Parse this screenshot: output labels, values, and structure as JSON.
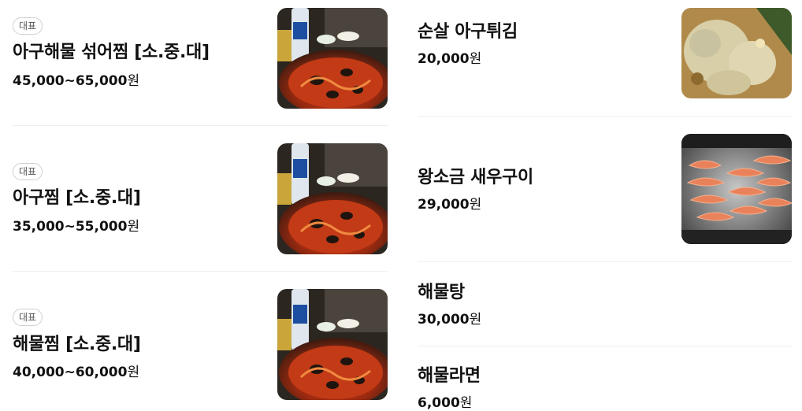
{
  "left_items": [
    {
      "badge": "대표",
      "name": "아구해물 섞어찜 [소.중.대]",
      "price": "45,000~65,000",
      "unit": "원",
      "image": "braised-seafood-photo"
    },
    {
      "badge": "대표",
      "name": "아구찜 [소.중.대]",
      "price": "35,000~55,000",
      "unit": "원",
      "image": "braised-seafood-photo"
    },
    {
      "badge": "대표",
      "name": "해물찜 [소.중.대]",
      "price": "40,000~60,000",
      "unit": "원",
      "image": "braised-seafood-photo"
    }
  ],
  "right_items": [
    {
      "name": "순살 아구튀김",
      "price": "20,000",
      "unit": "원",
      "image": "fried-monkfish-photo"
    },
    {
      "name": "왕소금 새우구이",
      "price": "29,000",
      "unit": "원",
      "image": "salt-grilled-shrimp-photo"
    },
    {
      "name": "해물탕",
      "price": "30,000",
      "unit": "원"
    },
    {
      "name": "해물라면",
      "price": "6,000",
      "unit": "원"
    }
  ]
}
